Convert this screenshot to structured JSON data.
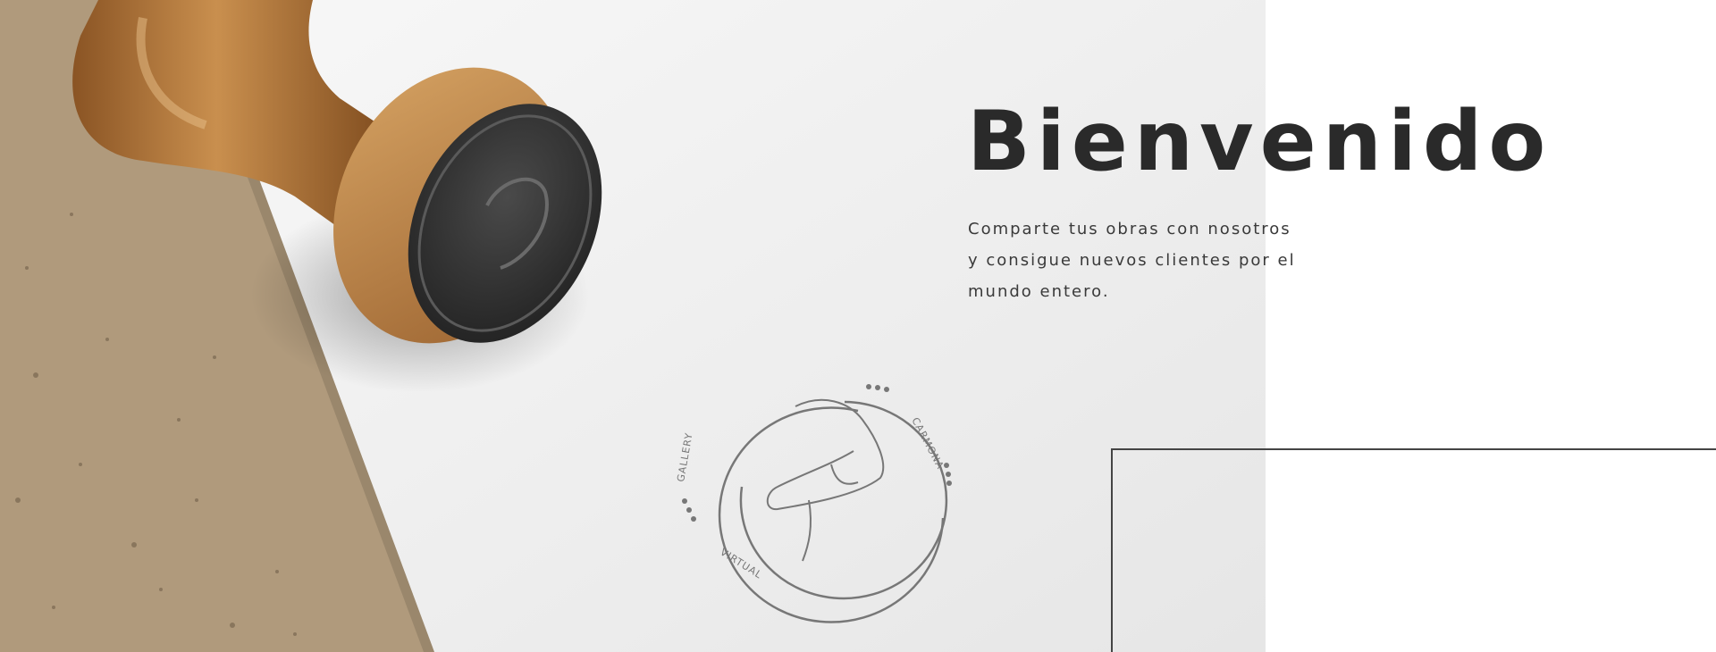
{
  "hero": {
    "title": "Bienvenido",
    "description_lines": [
      "Comparte tus obras con nosotros",
      "y consigue nuevos clientes por el",
      "mundo entero."
    ]
  },
  "stamp_imprint": {
    "text_top": "CARMONA",
    "text_left": "GALLERY",
    "text_bottom": "VIRTUAL"
  },
  "colors": {
    "title": "#2a2a2a",
    "paper": "#eeeeee",
    "cork": "#b09a7c",
    "wood": "#b07a3e",
    "rubber": "#2e2e2e",
    "stamp_ink": "#777777"
  },
  "icons": {
    "stamp_logo": "hand-sketch-icon"
  }
}
